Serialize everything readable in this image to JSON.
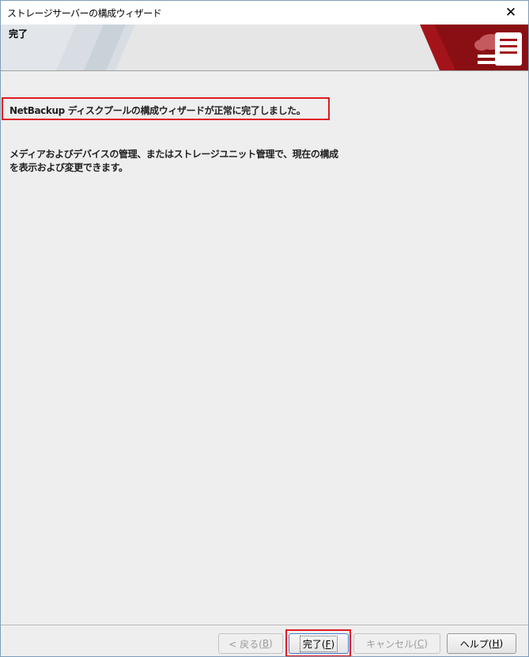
{
  "window": {
    "title": "ストレージサーバーの構成ウィザード",
    "close_glyph": "✕"
  },
  "banner": {
    "title": "完了",
    "accent_color": "#a3141a",
    "logo_icon": "cloud-server-icon"
  },
  "content": {
    "message_main": "NetBackup ディスクプールの構成ウィザードが正常に完了しました。",
    "description_lines": [
      "メディアおよびデバイスの管理、またはストレージユニット管理で、現在の構成",
      "を表示および変更できます。"
    ]
  },
  "buttons": {
    "back": {
      "label": "< 戻る(",
      "mnemonic": "B",
      "suffix": ")",
      "enabled": false
    },
    "finish": {
      "label": "完了(",
      "mnemonic": "F",
      "suffix": ")",
      "enabled": true
    },
    "cancel": {
      "label": "キャンセル(",
      "mnemonic": "C",
      "suffix": ")",
      "enabled": false
    },
    "help": {
      "label": "ヘルプ(",
      "mnemonic": "H",
      "suffix": ")",
      "enabled": true
    }
  },
  "colors": {
    "highlight": "#e01b24",
    "window_bg": "#eeeeee"
  }
}
